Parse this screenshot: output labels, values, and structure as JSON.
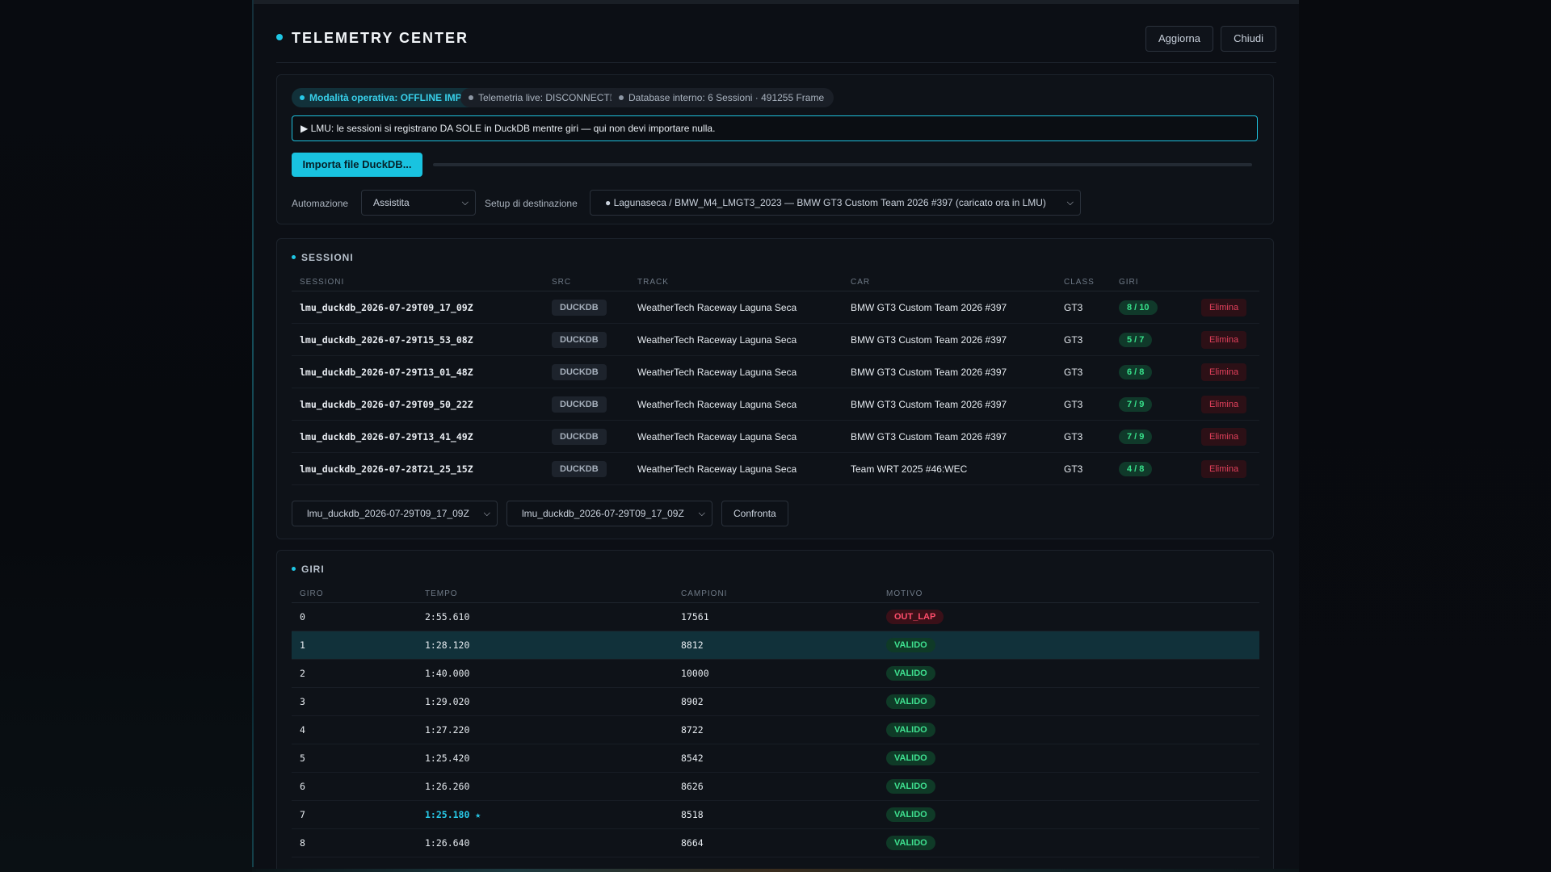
{
  "header": {
    "title": "TELEMETRY CENTER",
    "refresh_label": "Aggiorna",
    "close_label": "Chiudi"
  },
  "status": {
    "mode": "Modalità operativa: OFFLINE IMPORT",
    "live": "Telemetria live: DISCONNECTED",
    "db": "Database interno: 6 Sessioni · 491255 Frame"
  },
  "notice": "▶ LMU: le sessioni si registrano DA SOLE in DuckDB mentre giri — qui non devi importare nulla.",
  "import": {
    "button_label": "Importa file DuckDB...",
    "progress": 0
  },
  "automation": {
    "label": "Automazione",
    "value": "Assistita"
  },
  "setup": {
    "label": "Setup di destinazione",
    "value": "● Lagunaseca / BMW_M4_LMGT3_2023 — BMW GT3 Custom Team 2026 #397 (caricato ora in LMU)"
  },
  "sessions": {
    "title": "SESSIONI",
    "columns": [
      "SESSIONI",
      "SRC",
      "TRACK",
      "CAR",
      "CLASS",
      "GIRI"
    ],
    "delete_label": "Elimina",
    "rows": [
      {
        "name": "lmu_duckdb_2026-07-29T09_17_09Z",
        "src": "DUCKDB",
        "track": "WeatherTech Raceway Laguna Seca",
        "car": "BMW GT3 Custom Team 2026 #397",
        "class": "GT3",
        "giri": "8 / 10"
      },
      {
        "name": "lmu_duckdb_2026-07-29T15_53_08Z",
        "src": "DUCKDB",
        "track": "WeatherTech Raceway Laguna Seca",
        "car": "BMW GT3 Custom Team 2026 #397",
        "class": "GT3",
        "giri": "5 / 7"
      },
      {
        "name": "lmu_duckdb_2026-07-29T13_01_48Z",
        "src": "DUCKDB",
        "track": "WeatherTech Raceway Laguna Seca",
        "car": "BMW GT3 Custom Team 2026 #397",
        "class": "GT3",
        "giri": "6 / 8"
      },
      {
        "name": "lmu_duckdb_2026-07-29T09_50_22Z",
        "src": "DUCKDB",
        "track": "WeatherTech Raceway Laguna Seca",
        "car": "BMW GT3 Custom Team 2026 #397",
        "class": "GT3",
        "giri": "7 / 9"
      },
      {
        "name": "lmu_duckdb_2026-07-29T13_41_49Z",
        "src": "DUCKDB",
        "track": "WeatherTech Raceway Laguna Seca",
        "car": "BMW GT3 Custom Team 2026 #397",
        "class": "GT3",
        "giri": "7 / 9"
      },
      {
        "name": "lmu_duckdb_2026-07-28T21_25_15Z",
        "src": "DUCKDB",
        "track": "WeatherTech Raceway Laguna Seca",
        "car": "Team WRT 2025 #46:WEC",
        "class": "GT3",
        "giri": "4 / 8"
      }
    ],
    "compare_a": "lmu_duckdb_2026-07-29T09_17_09Z",
    "compare_b": "lmu_duckdb_2026-07-29T09_17_09Z",
    "compare_label": "Confronta"
  },
  "laps": {
    "title": "GIRI",
    "columns": [
      "GIRO",
      "TEMPO",
      "CAMPIONI",
      "MOTIVO"
    ],
    "rows": [
      {
        "giro": "0",
        "tempo": "2:55.610",
        "campioni": "17561",
        "motivo": "OUT_LAP",
        "status": "out"
      },
      {
        "giro": "1",
        "tempo": "1:28.120",
        "campioni": "8812",
        "motivo": "VALIDO",
        "status": "ok",
        "selected": true
      },
      {
        "giro": "2",
        "tempo": "1:40.000",
        "campioni": "10000",
        "motivo": "VALIDO",
        "status": "ok"
      },
      {
        "giro": "3",
        "tempo": "1:29.020",
        "campioni": "8902",
        "motivo": "VALIDO",
        "status": "ok"
      },
      {
        "giro": "4",
        "tempo": "1:27.220",
        "campioni": "8722",
        "motivo": "VALIDO",
        "status": "ok"
      },
      {
        "giro": "5",
        "tempo": "1:25.420",
        "campioni": "8542",
        "motivo": "VALIDO",
        "status": "ok"
      },
      {
        "giro": "6",
        "tempo": "1:26.260",
        "campioni": "8626",
        "motivo": "VALIDO",
        "status": "ok"
      },
      {
        "giro": "7",
        "tempo": "1:25.180 ★",
        "campioni": "8518",
        "motivo": "VALIDO",
        "status": "ok",
        "best": true
      },
      {
        "giro": "8",
        "tempo": "1:26.640",
        "campioni": "8664",
        "motivo": "VALIDO",
        "status": "ok"
      }
    ]
  }
}
